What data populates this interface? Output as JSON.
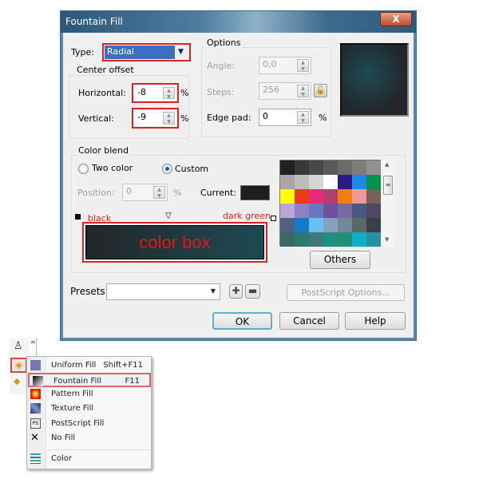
{
  "dialog": {
    "title": "Fountain Fill",
    "close_label": "X",
    "type": {
      "label": "Type:",
      "value": "Radial"
    },
    "center_offset": {
      "group_label": "Center offset",
      "horizontal_label": "Horizontal:",
      "horizontal_value": "-8",
      "vertical_label": "Vertical:",
      "vertical_value": "-9",
      "unit": "%"
    },
    "options": {
      "group_label": "Options",
      "angle_label": "Angle:",
      "angle_value": "0,0",
      "steps_label": "Steps:",
      "steps_value": "256",
      "edge_pad_label": "Edge pad:",
      "edge_pad_value": "0",
      "unit": "%"
    },
    "color_blend": {
      "group_label": "Color blend",
      "two_color_label": "Two color",
      "custom_label": "Custom",
      "selected": "Custom",
      "position_label": "Position:",
      "position_value": "0",
      "position_unit": "%",
      "current_label": "Current:",
      "current_color": "#1c1e21",
      "annotation_left": "black",
      "annotation_right": "dark green",
      "annotation_box": "color box",
      "gradient_start": "#22262a",
      "gradient_end": "#1e4a52",
      "palette": [
        "#231f1d",
        "#3a3735",
        "#4a4846",
        "#5c5a58",
        "#6e6c6a",
        "#7f7d7b",
        "#919090",
        "#a8a6a5",
        "#bdbcbb",
        "#d6d5d4",
        "#ffffff",
        "#2d1a80",
        "#1a8ae6",
        "#059050",
        "#ffff00",
        "#ee3a1a",
        "#e82a78",
        "#b04070",
        "#f08010",
        "#f09898",
        "#786058",
        "#b8a8d8",
        "#9080c0",
        "#6878c0",
        "#7050a0",
        "#7868a0",
        "#485880",
        "#504860",
        "#506080",
        "#1878c8",
        "#68c0f0",
        "#88a0c0",
        "#708898",
        "#586868",
        "#384048",
        "#3a6868",
        "#2a7870",
        "#407878",
        "#209080",
        "#20907a",
        "#10b0c8",
        "#2890a0"
      ],
      "others_label": "Others"
    },
    "presets": {
      "label": "Presets:",
      "value": ""
    },
    "postscript_label": "PostScript Options...",
    "ok_label": "OK",
    "cancel_label": "Cancel",
    "help_label": "Help"
  },
  "flyout": {
    "items": [
      {
        "label": "Uniform Fill",
        "shortcut": "Shift+F11",
        "icon": "uniform-fill-icon"
      },
      {
        "label": "Fountain Fill",
        "shortcut": "F11",
        "icon": "fountain-fill-icon"
      },
      {
        "label": "Pattern Fill",
        "shortcut": "",
        "icon": "pattern-fill-icon"
      },
      {
        "label": "Texture Fill",
        "shortcut": "",
        "icon": "texture-fill-icon"
      },
      {
        "label": "PostScript Fill",
        "shortcut": "",
        "icon": "postscript-fill-icon"
      },
      {
        "label": "No Fill",
        "shortcut": "",
        "icon": "no-fill-icon"
      },
      {
        "label": "Color",
        "shortcut": "",
        "icon": "color-icon"
      }
    ],
    "highlighted": "Fountain Fill"
  }
}
